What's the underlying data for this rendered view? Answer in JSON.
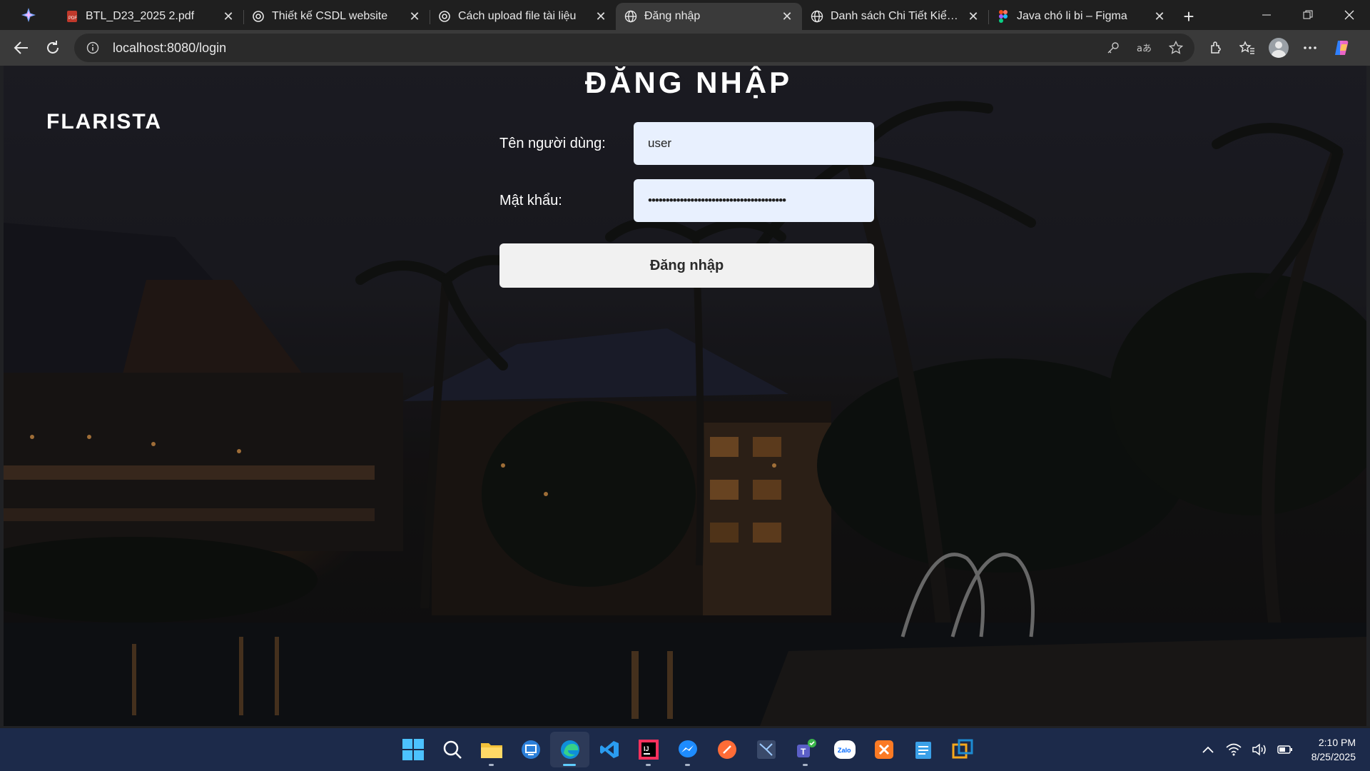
{
  "browser": {
    "tabs": [
      {
        "title": "BTL_D23_2025 2.pdf",
        "icon": "pdf-icon",
        "active": false
      },
      {
        "title": "Thiết kế CSDL website",
        "icon": "chatgpt-icon",
        "active": false
      },
      {
        "title": "Cách upload file tài liệu",
        "icon": "chatgpt-icon",
        "active": false
      },
      {
        "title": "Đăng nhập",
        "icon": "globe-icon",
        "active": true
      },
      {
        "title": "Danh sách Chi Tiết Kiểm Tra",
        "icon": "globe-icon",
        "active": false
      },
      {
        "title": "Java chó li bi – Figma",
        "icon": "figma-icon",
        "active": false
      }
    ],
    "url": "localhost:8080/login"
  },
  "page": {
    "brand": "FLARISTA",
    "title": "ĐĂNG NHẬP",
    "username_label": "Tên người dùng:",
    "username_value": "user",
    "password_label": "Mật khẩu:",
    "password_value": "•••••••••••••••••••••••••••••••••••••••",
    "submit_label": "Đăng nhập"
  },
  "taskbar": {
    "apps": [
      "start-icon",
      "search-icon",
      "file-explorer-icon",
      "remote-desktop-icon",
      "edge-icon",
      "vscode-icon",
      "intellij-icon",
      "messenger-icon",
      "postman-icon",
      "ssms-icon",
      "teams-icon",
      "zalo-icon",
      "xampp-icon",
      "notepad-icon",
      "virtualbox-icon"
    ],
    "time": "2:10 PM",
    "date": "8/25/2025"
  },
  "colors": {
    "chrome_bg": "#1f1f1f",
    "toolbar_bg": "#3a3a3a",
    "input_bg": "#e8f0fe",
    "button_bg": "#f1f1f1",
    "taskbar_bg": "#1c2a4a"
  }
}
